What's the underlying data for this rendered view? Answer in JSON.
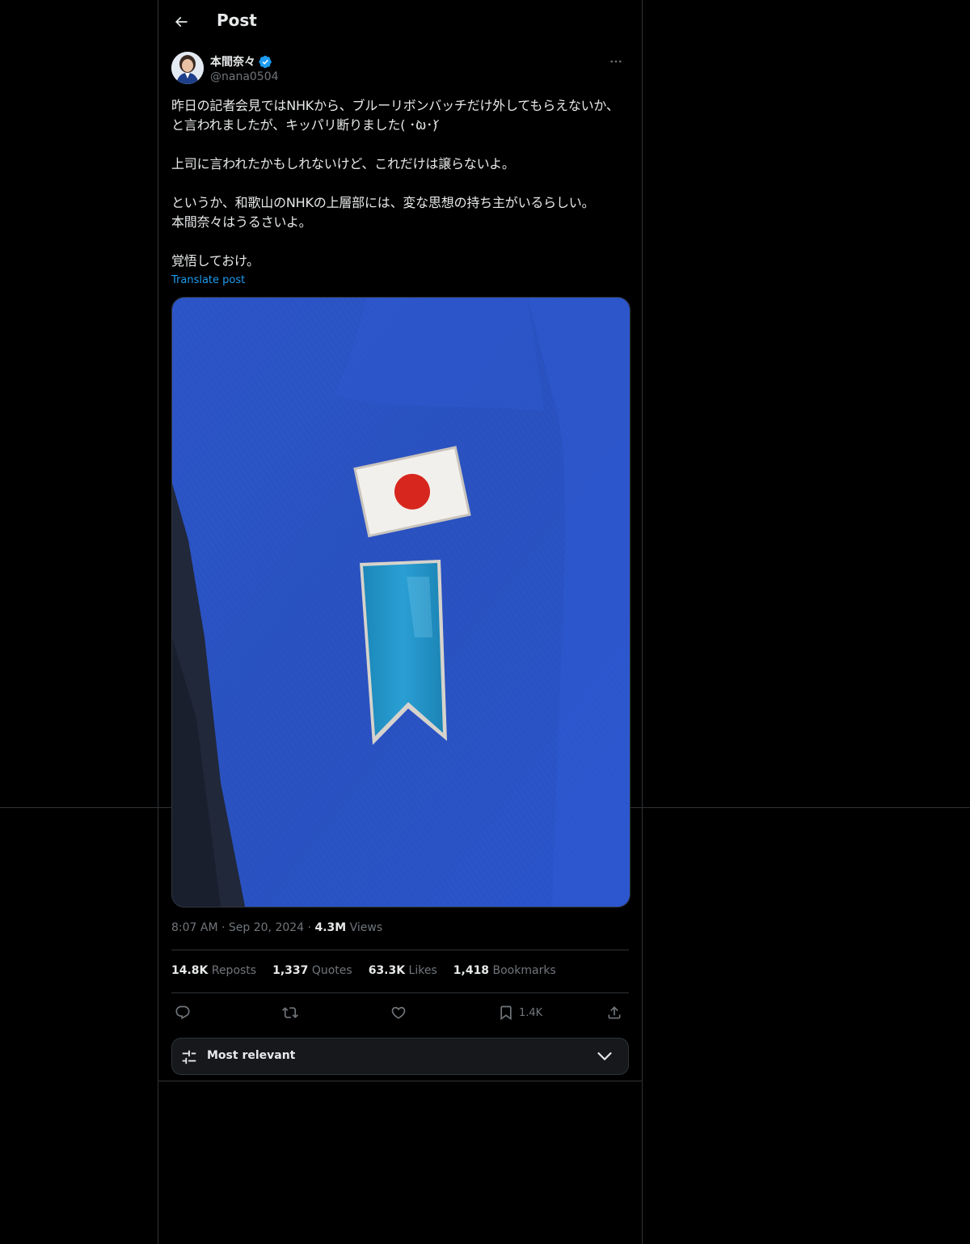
{
  "header": {
    "title": "Post",
    "back_icon": "arrow-left-icon"
  },
  "author": {
    "display_name": "本間奈々",
    "handle": "@nana0504",
    "verified": true,
    "verified_color": "#1d9bf0"
  },
  "post": {
    "text": "昨日の記者会見ではNHKから、ブルーリボンバッチだけ外してもらえないか、と言われましたが、キッパリ断りました( ･̀ω･́)\n\n上司に言われたかもしれないけど、これだけは譲らないよ。\n\nというか、和歌山のNHKの上層部には、変な思想の持ち主がいるらしい。\n本間奈々はうるさいよ。\n\n覚悟しておけ。",
    "translate_label": "Translate post"
  },
  "meta": {
    "time": "8:07 AM",
    "date": "Sep 20, 2024",
    "views_count": "4.3M",
    "views_label": "Views",
    "separator": "·"
  },
  "stats": [
    {
      "count": "14.8K",
      "label": "Reposts"
    },
    {
      "count": "1,337",
      "label": "Quotes"
    },
    {
      "count": "63.3K",
      "label": "Likes"
    },
    {
      "count": "1,418",
      "label": "Bookmarks"
    }
  ],
  "actions": {
    "reply_icon": "reply-icon",
    "repost_icon": "repost-icon",
    "like_icon": "heart-icon",
    "bookmark_icon": "bookmark-icon",
    "bookmark_count": "1.4K",
    "share_icon": "share-icon"
  },
  "sort": {
    "label": "Most relevant",
    "icon": "sliders-icon",
    "chevron": "chevron-down-icon"
  },
  "colors": {
    "accent": "#1d9bf0",
    "background": "#000000",
    "border": "#2f3336",
    "muted": "#71767b"
  }
}
